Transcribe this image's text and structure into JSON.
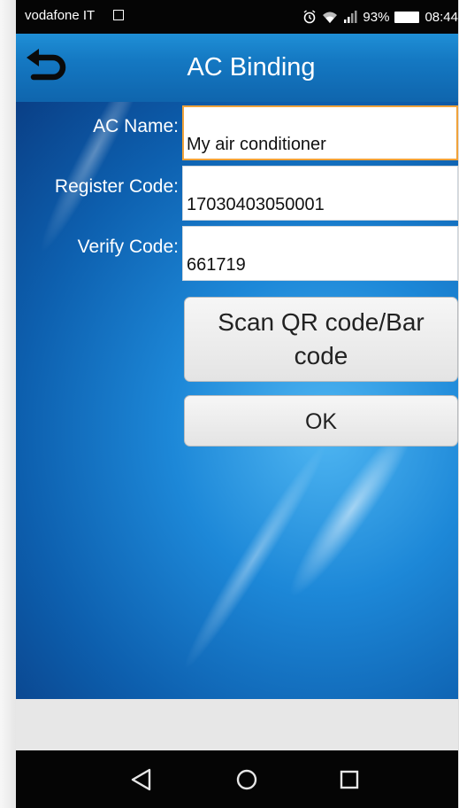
{
  "status_bar": {
    "carrier": "vodafone IT",
    "battery_percent": "93%",
    "time": "08:44"
  },
  "title_bar": {
    "title": "AC Binding"
  },
  "form": {
    "ac_name_label": "AC Name:",
    "ac_name_value": "My air conditioner",
    "register_code_label": "Register Code:",
    "register_code_value": "17030403050001",
    "verify_code_label": "Verify Code:",
    "verify_code_value": "661719"
  },
  "buttons": {
    "scan_line1": "Scan QR code/Bar",
    "scan_line2": "code",
    "ok": "OK"
  },
  "icons": {
    "back": "back-arrow-icon",
    "nav_back": "triangle-back-icon",
    "nav_home": "circle-home-icon",
    "nav_recent": "square-recent-icon"
  },
  "colors": {
    "title_bar": "#1478c2",
    "background": "#1d88d8",
    "focus_border": "#f0a23a"
  }
}
